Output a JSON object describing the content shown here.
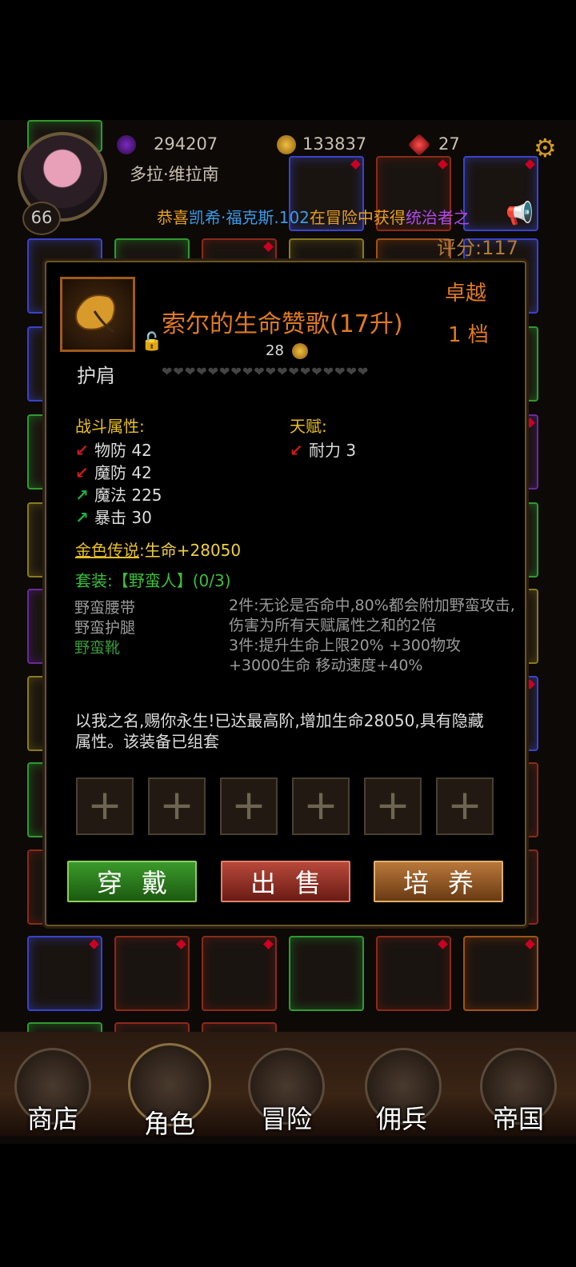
{
  "player": {
    "level": "66",
    "name": "多拉·维拉南",
    "res1": "294207",
    "res2": "133837",
    "res3": "27",
    "score": "评分:117"
  },
  "marquee": {
    "prefix": "恭喜",
    "hero": "凯希·福克斯.102",
    "mid": "在冒险中获得",
    "item": "统治者之"
  },
  "item": {
    "title": "索尔的生命赞歌(17升)",
    "rank": "卓越",
    "tier": "1 档",
    "price": "28",
    "slot": "护肩",
    "hearts": "❤❤❤❤❤❤❤❤❤❤❤❤❤❤❤❤❤❤",
    "combat_title": "战斗属性:",
    "combat": [
      {
        "dir": "down",
        "text": "物防 42"
      },
      {
        "dir": "down",
        "text": "魔防 42"
      },
      {
        "dir": "up",
        "text": "魔法 225"
      },
      {
        "dir": "up",
        "text": "暴击 30"
      }
    ],
    "talent_title": "天赋:",
    "talent": [
      {
        "dir": "down",
        "text": "耐力 3"
      }
    ],
    "legend_label": "金色传说",
    "legend_sep": ":",
    "legend_value": "生命+28050",
    "set_title": "套装:【野蛮人】(0/3)",
    "set_items": [
      "野蛮腰带",
      "野蛮护腿",
      "野蛮靴"
    ],
    "set_desc": [
      "2件:无论是否命中,80%都会附加野蛮攻击,伤害为所有天赋属性之和的2倍",
      "3件:提升生命上限20% +300物攻 +3000生命 移动速度+40%"
    ],
    "flavor": "以我之名,赐你永生!已达最高阶,增加生命28050,具有隐藏属性。该装备已组套"
  },
  "actions": {
    "wear": "穿戴",
    "sell": "出售",
    "train": "培养",
    "socket": "+"
  },
  "nav": {
    "shop": "商店",
    "role": "角色",
    "adventure": "冒险",
    "mercenary": "佣兵",
    "empire": "帝国"
  },
  "colors": {
    "accent": "#e07a20",
    "stat_title": "#e8c020",
    "set_green": "#3ac03a"
  }
}
